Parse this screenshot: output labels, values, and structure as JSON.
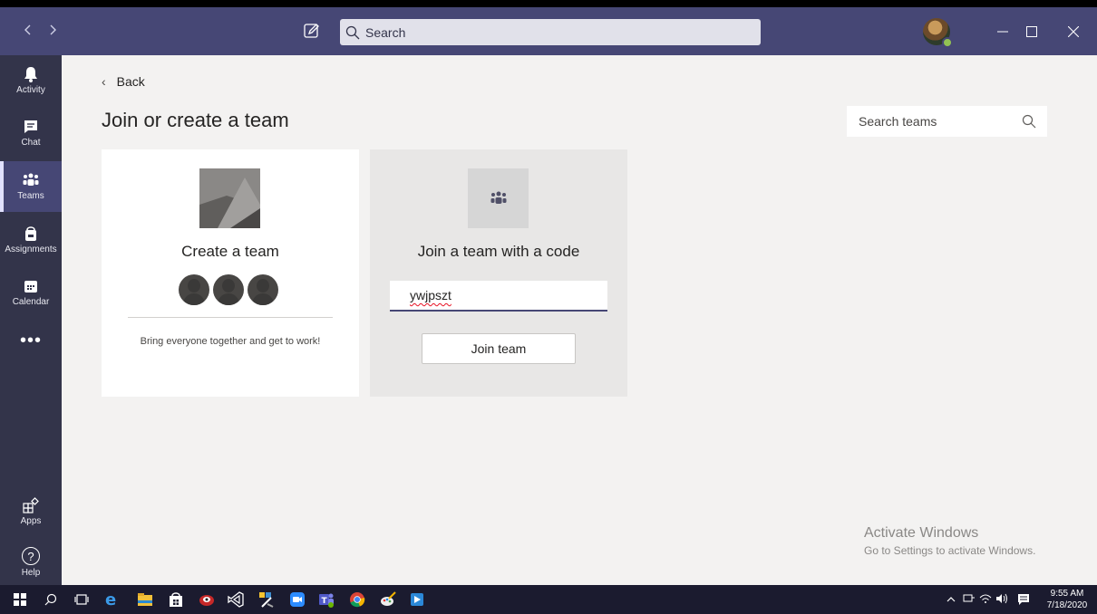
{
  "titlebar": {
    "search_placeholder": "Search",
    "back_icon": "chevron-left-icon",
    "forward_icon": "chevron-right-icon",
    "compose_icon": "compose-icon",
    "minimize_glyph": "–",
    "maximize_glyph": "☐",
    "close_glyph": "✕",
    "bg_color": "#464775"
  },
  "rail": {
    "items": [
      {
        "label": "Activity",
        "icon": "bell-icon"
      },
      {
        "label": "Chat",
        "icon": "chat-icon"
      },
      {
        "label": "Teams",
        "icon": "teams-icon",
        "active": true
      },
      {
        "label": "Assignments",
        "icon": "assignments-icon"
      },
      {
        "label": "Calendar",
        "icon": "calendar-icon"
      }
    ],
    "more": "•••",
    "apps_label": "Apps",
    "help_label": "Help",
    "help_glyph": "?"
  },
  "main": {
    "back_label": "Back",
    "back_glyph": "‹",
    "title": "Join or create a team",
    "search_teams_placeholder": "Search teams",
    "create_card": {
      "title": "Create a team",
      "description": "Bring everyone together and get to work!"
    },
    "join_card": {
      "title": "Join a team with a code",
      "code_value": "ywjpszt",
      "button_label": "Join team"
    }
  },
  "watermark": {
    "line1": "Activate Windows",
    "line2": "Go to Settings to activate Windows."
  },
  "taskbar": {
    "time": "9:55 AM",
    "date": "7/18/2020",
    "tray_chevron": "^",
    "icons": [
      "windows-start-icon",
      "search-icon",
      "task-view-icon",
      "edge-icon",
      "file-explorer-icon",
      "store-icon",
      "app-red-icon",
      "visual-studio-icon",
      "paint-tool-icon",
      "zoom-icon",
      "teams-icon",
      "chrome-icon",
      "paint-brush-icon",
      "media-player-icon"
    ]
  },
  "colors": {
    "accent": "#464775",
    "rail": "#33344a",
    "background": "#f3f2f1"
  }
}
